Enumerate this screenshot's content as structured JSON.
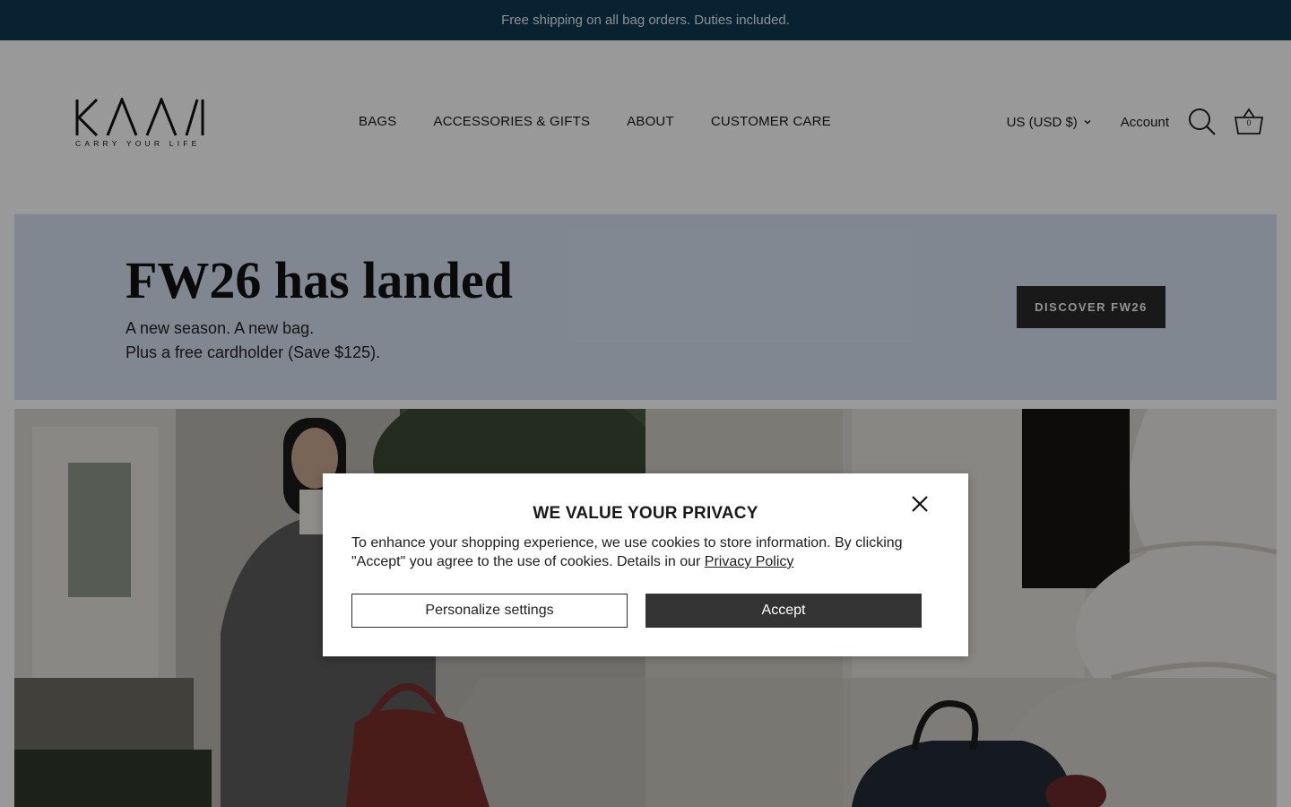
{
  "announcement": "Free shipping on all bag orders. Duties included.",
  "brand": {
    "name": "KAAI",
    "tagline": "CARRY YOUR LIFE"
  },
  "nav": [
    "BAGS",
    "ACCESSORIES & GIFTS",
    "ABOUT",
    "CUSTOMER CARE"
  ],
  "header": {
    "currency": "US (USD $)",
    "account": "Account",
    "cart_count": "0"
  },
  "promo": {
    "title": "FW26 has landed",
    "line1": "A new season. A new bag.",
    "line2": "Plus a free cardholder (Save $125).",
    "button": "DISCOVER FW26",
    "background": "#d7e2f1"
  },
  "cookie_modal": {
    "title": "WE VALUE YOUR PRIVACY",
    "text": "To enhance your shopping experience, we use cookies to store information. By clicking \"Accept\" you agree to the use of cookies. Details in our ",
    "link": "Privacy Policy",
    "personalize_label": "Personalize settings",
    "accept_label": "Accept"
  },
  "icons": [
    "search-icon",
    "basket-icon",
    "chevron-down-icon",
    "close-icon"
  ],
  "colors": {
    "announcement_bar": "#0e3a52",
    "button_dark": "#2b2b2b",
    "overlay": "rgba(0,0,0,0.4)"
  }
}
